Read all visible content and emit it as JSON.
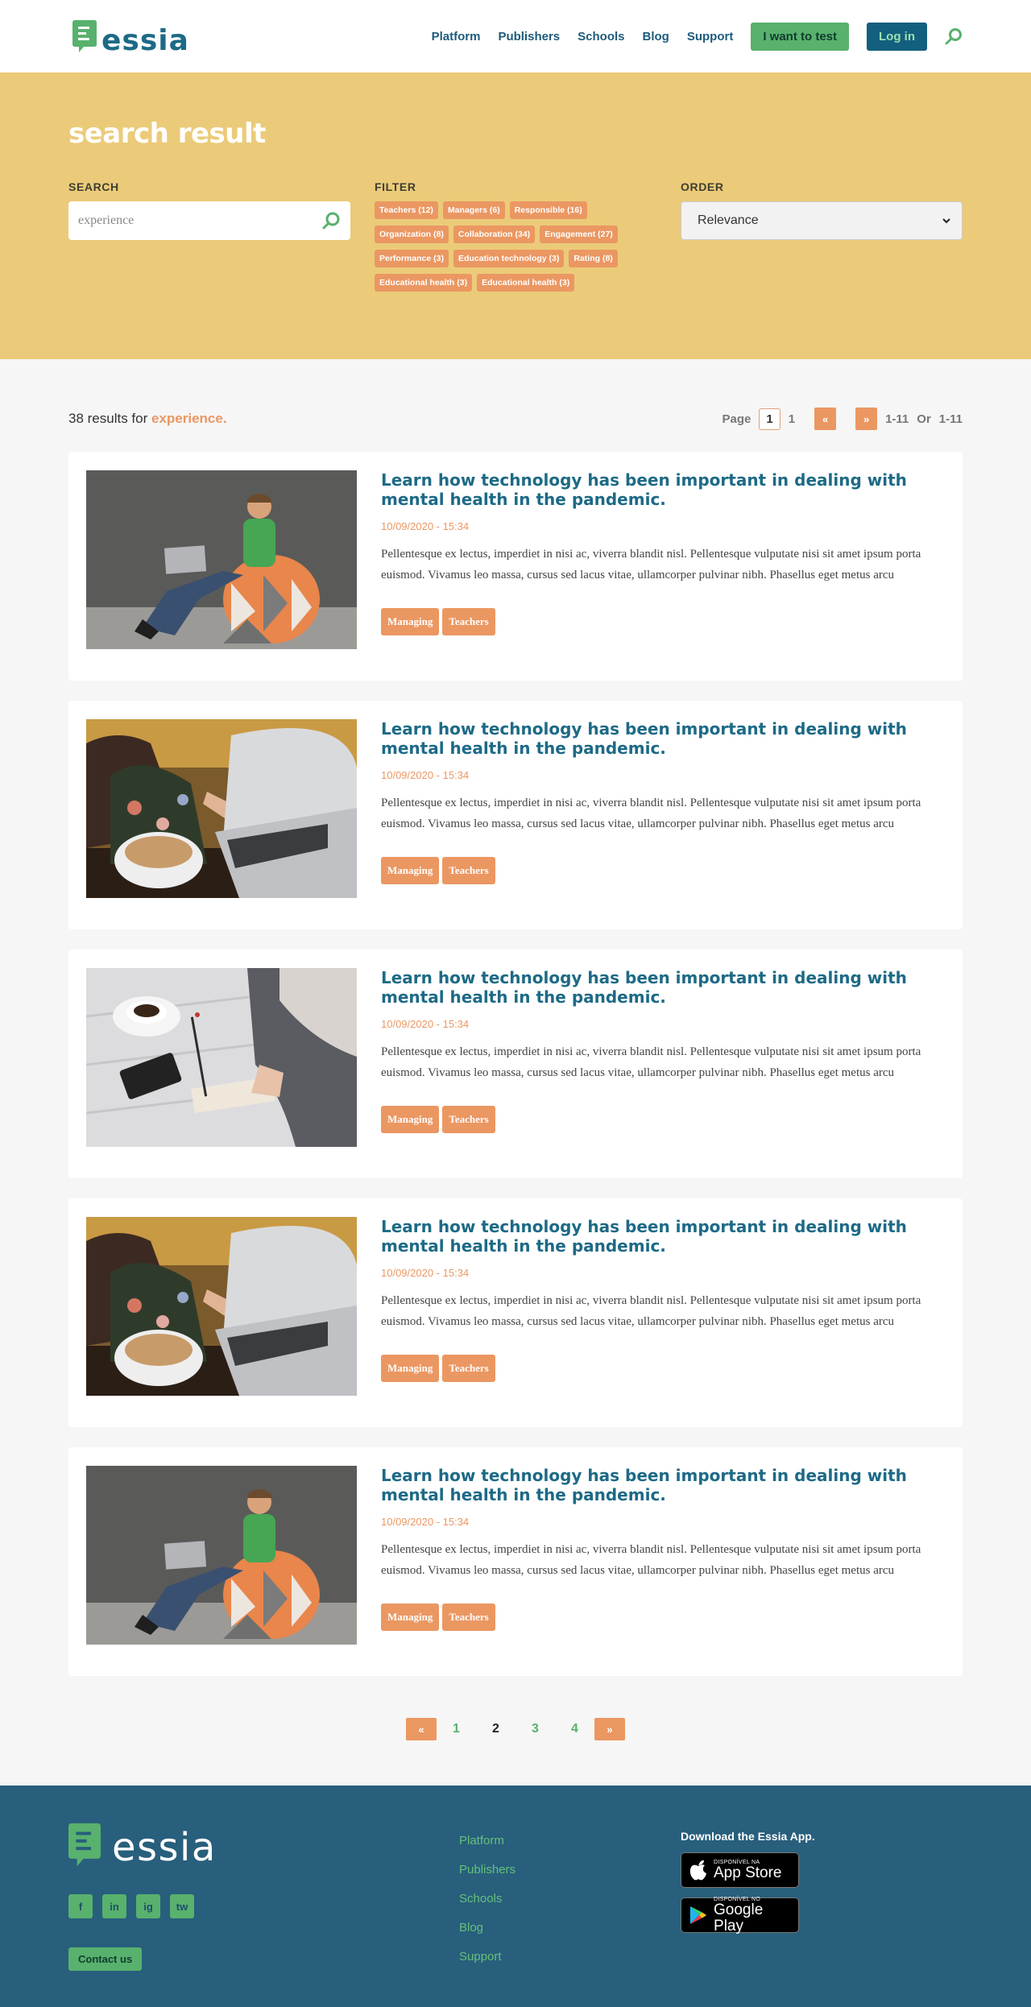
{
  "header": {
    "logo_text": "essia",
    "nav": [
      "Platform",
      "Publishers",
      "Schools",
      "Blog",
      "Support"
    ],
    "test_button": "I want to test",
    "login_button": "Log in"
  },
  "hero": {
    "title": "search result",
    "search_label": "SEARCH",
    "search_value": "experience",
    "filter_label": "FILTER",
    "filters": [
      "Teachers (12)",
      "Managers (6)",
      "Responsible (16)",
      "Organization (8)",
      "Collaboration (34)",
      "Engagement (27)",
      "Performance (3)",
      "Education technology (3)",
      "Rating (8)",
      "Educational health (3)",
      "Educational health (3)"
    ],
    "order_label": "ORDER",
    "order_value": "Relevance"
  },
  "results": {
    "count_text": "38 results for",
    "term": "experience.",
    "pager_top": {
      "page_label": "Page",
      "current": "1",
      "total": "1",
      "prev": "«",
      "next": "»",
      "range1": "1-11",
      "or": "Or",
      "range2": "1-11"
    },
    "items": [
      {
        "title": "Learn how technology has been important in dealing with mental health in the pandemic.",
        "date": "10/09/2020 - 15:34",
        "text": "Pellentesque ex lectus, imperdiet in nisi ac, viverra blandit nisl. Pellentesque vulputate nisi sit amet ipsum porta euismod. Vivamus leo massa, cursus sed lacus vitae, ullamcorper pulvinar nibh. Phasellus eget metus arcu",
        "tags": [
          "Managing",
          "Teachers"
        ]
      },
      {
        "title": "Learn how technology has been important in dealing with mental health in the pandemic.",
        "date": "10/09/2020 - 15:34",
        "text": "Pellentesque ex lectus, imperdiet in nisi ac, viverra blandit nisl. Pellentesque vulputate nisi sit amet ipsum porta euismod. Vivamus leo massa, cursus sed lacus vitae, ullamcorper pulvinar nibh. Phasellus eget metus arcu",
        "tags": [
          "Managing",
          "Teachers"
        ]
      },
      {
        "title": "Learn how technology has been important in dealing with mental health in the pandemic.",
        "date": "10/09/2020 - 15:34",
        "text": "Pellentesque ex lectus, imperdiet in nisi ac, viverra blandit nisl. Pellentesque vulputate nisi sit amet ipsum porta euismod. Vivamus leo massa, cursus sed lacus vitae, ullamcorper pulvinar nibh. Phasellus eget metus arcu",
        "tags": [
          "Managing",
          "Teachers"
        ]
      },
      {
        "title": "Learn how technology has been important in dealing with mental health in the pandemic.",
        "date": "10/09/2020 - 15:34",
        "text": "Pellentesque ex lectus, imperdiet in nisi ac, viverra blandit nisl. Pellentesque vulputate nisi sit amet ipsum porta euismod. Vivamus leo massa, cursus sed lacus vitae, ullamcorper pulvinar nibh. Phasellus eget metus arcu",
        "tags": [
          "Managing",
          "Teachers"
        ]
      },
      {
        "title": "Learn how technology has been important in dealing with mental health in the pandemic.",
        "date": "10/09/2020 - 15:34",
        "text": "Pellentesque ex lectus, imperdiet in nisi ac, viverra blandit nisl. Pellentesque vulputate nisi sit amet ipsum porta euismod. Vivamus leo massa, cursus sed lacus vitae, ullamcorper pulvinar nibh. Phasellus eget metus arcu",
        "tags": [
          "Managing",
          "Teachers"
        ]
      }
    ],
    "pager_bottom": {
      "prev": "«",
      "pages": [
        "1",
        "2",
        "3",
        "4"
      ],
      "next": "»"
    }
  },
  "footer": {
    "logo_text": "essia",
    "socials": [
      "f",
      "in",
      "ig",
      "tw"
    ],
    "contact_button": "Contact us",
    "links": [
      "Platform",
      "Publishers",
      "Schools",
      "Blog",
      "Support"
    ],
    "app_title": "Download the Essia App.",
    "app_store_small": "DISPONÍVEL NA",
    "app_store_big": "App Store",
    "play_small": "DISPONÍVEL NO",
    "play_big": "Google Play"
  },
  "colors": {
    "accent_orange": "#eb9762",
    "brand_green": "#58b16d",
    "brand_blue": "#1d6a86",
    "hero_yellow": "#ebcb79",
    "footer_blue": "#285f7c"
  }
}
